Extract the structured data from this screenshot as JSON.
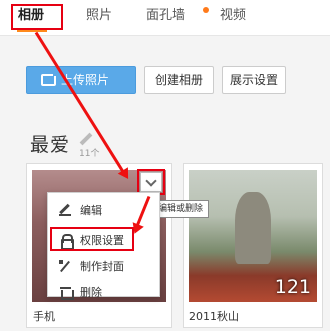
{
  "tabs": [
    {
      "label": "相册",
      "active": true
    },
    {
      "label": "照片"
    },
    {
      "label": "面孔墙",
      "has_new_dot": true
    },
    {
      "label": "视频"
    }
  ],
  "toolbar": {
    "upload_label": "上传照片",
    "create_album_label": "创建相册",
    "display_settings_label": "展示设置"
  },
  "album_section": {
    "title": "最爱",
    "count": "11个"
  },
  "albums": [
    {
      "name": "手机",
      "cover": "reddish-photo"
    },
    {
      "name": "2011秋山",
      "photo_count": "121",
      "cover": "autumn-mountain-photo"
    }
  ],
  "tooltip": "编辑或删除",
  "menu": {
    "items": [
      {
        "label": "编辑",
        "icon": "pencil-icon"
      },
      {
        "label": "权限设置",
        "icon": "lock-icon"
      },
      {
        "label": "制作封面",
        "icon": "wand-icon"
      },
      {
        "label": "删除",
        "icon": "trash-icon"
      }
    ]
  },
  "colors": {
    "accent_orange": "#ff8a1c",
    "upload_blue": "#5aa9e8",
    "highlight_red": "#e60012"
  }
}
